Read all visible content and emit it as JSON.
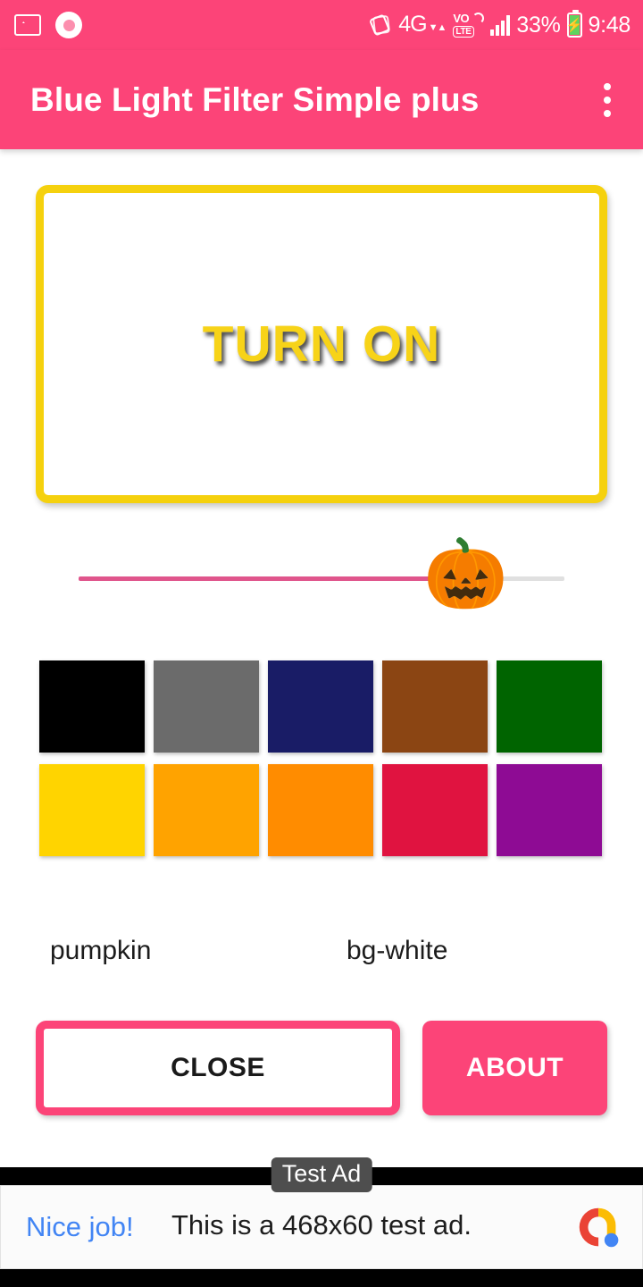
{
  "status_bar": {
    "background": "#fc4478",
    "left_icons": [
      {
        "name": "screenshot-icon",
        "label": "screenshot"
      },
      {
        "name": "screen-record-icon",
        "label": "screen-record"
      }
    ],
    "rotation_icon": "auto-rotate",
    "network": {
      "type": "4G",
      "arrows": "▼▲"
    },
    "volte": {
      "top": "VO",
      "bottom": "LTE"
    },
    "signal_bars": 4,
    "battery_percent": "33%",
    "battery_state": "charging",
    "clock": "9:48"
  },
  "app_bar": {
    "title": "Blue Light Filter Simple plus",
    "overflow_menu": "more-options",
    "background": "#fc4478"
  },
  "main": {
    "toggle": {
      "label": "TURN ON",
      "text_color": "#f7d318",
      "border_color": "#f5d10e",
      "background": "#ffffff"
    },
    "slider": {
      "name": "opacity-slider",
      "thumb_icon": "jack-o-lantern",
      "thumb_glyph": "🎃",
      "filled_color": "#e0558c",
      "track_color": "#e0e0e0",
      "value_percent": 77
    },
    "swatches": [
      {
        "name": "black",
        "color": "#000000"
      },
      {
        "name": "gray",
        "color": "#6b6b6b"
      },
      {
        "name": "navy",
        "color": "#191c66"
      },
      {
        "name": "brown",
        "color": "#8b4513"
      },
      {
        "name": "green",
        "color": "#006400"
      },
      {
        "name": "gold",
        "color": "#ffd400"
      },
      {
        "name": "amber",
        "color": "#ffa300"
      },
      {
        "name": "orange",
        "color": "#ff8c00"
      },
      {
        "name": "crimson",
        "color": "#e01340"
      },
      {
        "name": "purple",
        "color": "#8e0b94"
      }
    ],
    "labels": {
      "theme_name": "pumpkin",
      "background_name": "bg-white"
    },
    "buttons": {
      "close": "CLOSE",
      "about": "ABOUT",
      "accent": "#fc4478"
    }
  },
  "ad": {
    "badge": "Test Ad",
    "cta": "Nice job!",
    "text": "This is a 468x60 test ad.",
    "logo": "admob-logo",
    "cta_color": "#4285f4"
  }
}
